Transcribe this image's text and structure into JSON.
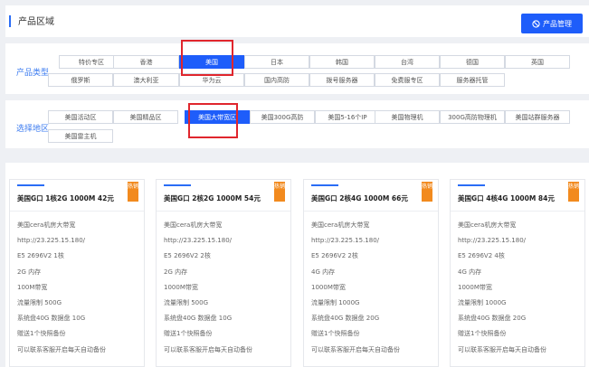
{
  "header": {
    "title": "产品区域",
    "manage_button": "产品管理"
  },
  "product_type": {
    "label": "产品类型",
    "options": [
      "特价专区",
      "香港",
      "美国",
      "日本",
      "韩国",
      "台湾",
      "德国",
      "英国",
      "俄罗斯",
      "澳大利亚",
      "华为云",
      "国内高防",
      "拨号服务器",
      "免费服专区",
      "服务器托管"
    ],
    "selected": "美国"
  },
  "region": {
    "label": "选择地区",
    "options": [
      "美国活动区",
      "美国精品区",
      "美国大带宽区",
      "美国300G高防",
      "美国5-16个IP",
      "美国物理机",
      "300G高防物理机",
      "美国站群服务器",
      "美国雷主机"
    ],
    "selected": "美国大带宽区"
  },
  "cards": [
    {
      "title": "美国G口 1核2G 1000M 42元",
      "badge": "热销",
      "features": [
        "美国cera机房大带宽",
        "http://23.225.15.180/",
        "E5 2696V2 1核",
        "2G 内存",
        "100M带宽",
        "流量限制 500G",
        "系统盘40G 数据盘 10G",
        "赠送1个快照备份",
        "可以联系客服开启每天自动备份"
      ]
    },
    {
      "title": "美国G口 2核2G 1000M 54元",
      "badge": "热销",
      "features": [
        "美国cera机房大带宽",
        "http://23.225.15.180/",
        "E5 2696V2 2核",
        "2G 内存",
        "1000M带宽",
        "流量限制 500G",
        "系统盘40G 数据盘 10G",
        "赠送1个快照备份",
        "可以联系客服开启每天自动备份"
      ]
    },
    {
      "title": "美国G口 2核4G 1000M 66元",
      "badge": "热销",
      "features": [
        "美国cera机房大带宽",
        "http://23.225.15.180/",
        "E5 2696V2 2核",
        "4G 内存",
        "1000M带宽",
        "流量限制 1000G",
        "系统盘40G 数据盘 20G",
        "赠送1个快照备份",
        "可以联系客服开启每天自动备份"
      ]
    },
    {
      "title": "美国G口 4核4G 1000M 84元",
      "badge": "热销",
      "features": [
        "美国cera机房大带宽",
        "http://23.225.15.180/",
        "E5 2696V2 4核",
        "4G 内存",
        "1000M带宽",
        "流量限制 1000G",
        "系统盘40G 数据盘 20G",
        "赠送1个快照备份",
        "可以联系客服开启每天自动备份"
      ]
    }
  ]
}
